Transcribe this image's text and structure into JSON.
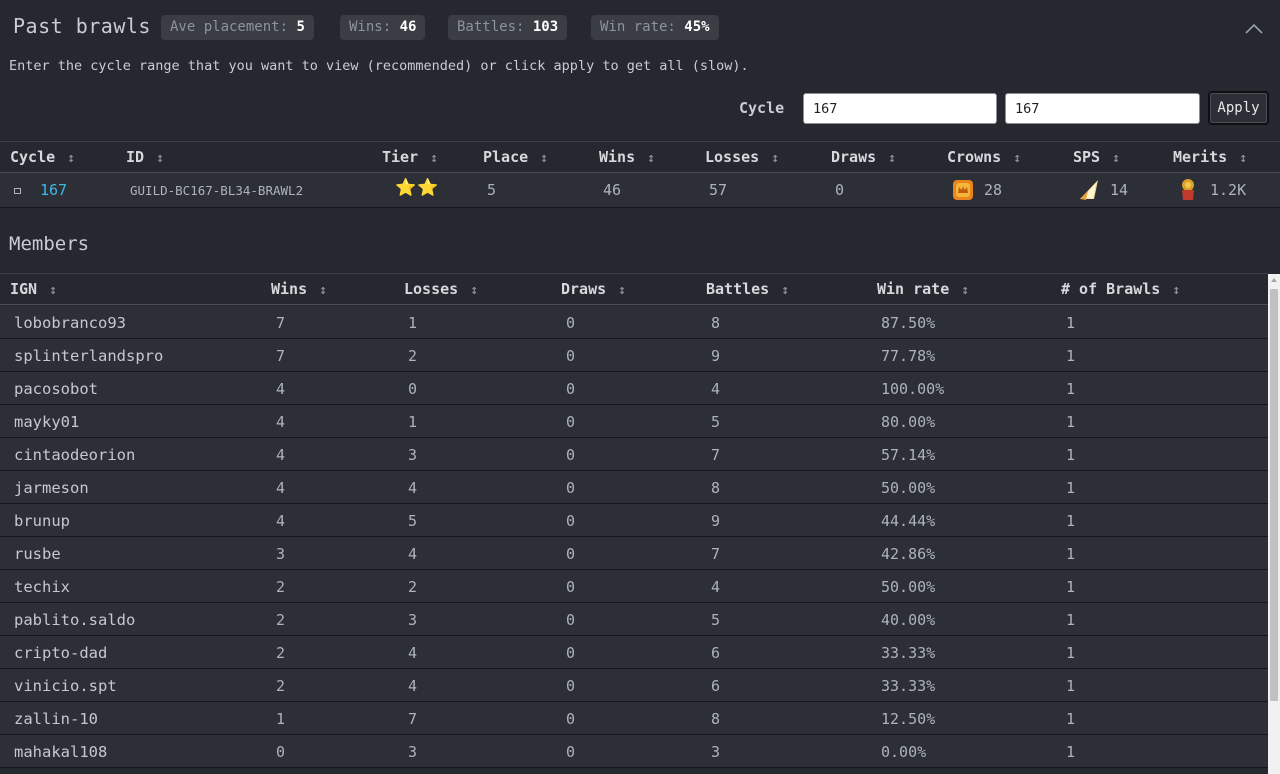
{
  "header": {
    "title": "Past brawls",
    "badges": [
      {
        "label": "Ave placement:",
        "value": "5"
      },
      {
        "label": "Wins:",
        "value": "46"
      },
      {
        "label": "Battles:",
        "value": "103"
      },
      {
        "label": "Win rate:",
        "value": "45%"
      }
    ],
    "collapse_icon": "chevron-up-icon"
  },
  "hint": "Enter the cycle range that you want to view (recommended) or click apply to get all (slow).",
  "range": {
    "label": "Cycle",
    "from": "167",
    "to": "167",
    "apply_label": "Apply"
  },
  "brawl_table": {
    "columns": [
      "Cycle",
      "ID",
      "Tier",
      "Place",
      "Wins",
      "Losses",
      "Draws",
      "Crowns",
      "SPS",
      "Merits"
    ],
    "sort_glyph": "↕",
    "row": {
      "cycle": "167",
      "id": "GUILD-BC167-BL34-BRAWL2",
      "tier": "⭐⭐",
      "place": "5",
      "wins": "46",
      "losses": "57",
      "draws": "0",
      "crowns": "28",
      "sps": "14",
      "merits": "1.2K"
    },
    "icons": {
      "crowns": "crown-icon",
      "sps": "sps-token-icon",
      "merits": "merits-icon"
    },
    "colors": {
      "link": "#3fb8e6",
      "star": "#f5c518"
    }
  },
  "members": {
    "title": "Members",
    "columns": [
      "IGN",
      "Wins",
      "Losses",
      "Draws",
      "Battles",
      "Win rate",
      "# of Brawls"
    ],
    "rows": [
      [
        "lobobranco93",
        "7",
        "1",
        "0",
        "8",
        "87.50%",
        "1"
      ],
      [
        "splinterlandspro",
        "7",
        "2",
        "0",
        "9",
        "77.78%",
        "1"
      ],
      [
        "pacosobot",
        "4",
        "0",
        "0",
        "4",
        "100.00%",
        "1"
      ],
      [
        "mayky01",
        "4",
        "1",
        "0",
        "5",
        "80.00%",
        "1"
      ],
      [
        "cintaodeorion",
        "4",
        "3",
        "0",
        "7",
        "57.14%",
        "1"
      ],
      [
        "jarmeson",
        "4",
        "4",
        "0",
        "8",
        "50.00%",
        "1"
      ],
      [
        "brunup",
        "4",
        "5",
        "0",
        "9",
        "44.44%",
        "1"
      ],
      [
        "rusbe",
        "3",
        "4",
        "0",
        "7",
        "42.86%",
        "1"
      ],
      [
        "techix",
        "2",
        "2",
        "0",
        "4",
        "50.00%",
        "1"
      ],
      [
        "pablito.saldo",
        "2",
        "3",
        "0",
        "5",
        "40.00%",
        "1"
      ],
      [
        "cripto-dad",
        "2",
        "4",
        "0",
        "6",
        "33.33%",
        "1"
      ],
      [
        "vinicio.spt",
        "2",
        "4",
        "0",
        "6",
        "33.33%",
        "1"
      ],
      [
        "zallin-10",
        "1",
        "7",
        "0",
        "8",
        "12.50%",
        "1"
      ],
      [
        "mahakal108",
        "0",
        "3",
        "0",
        "3",
        "0.00%",
        "1"
      ]
    ]
  }
}
